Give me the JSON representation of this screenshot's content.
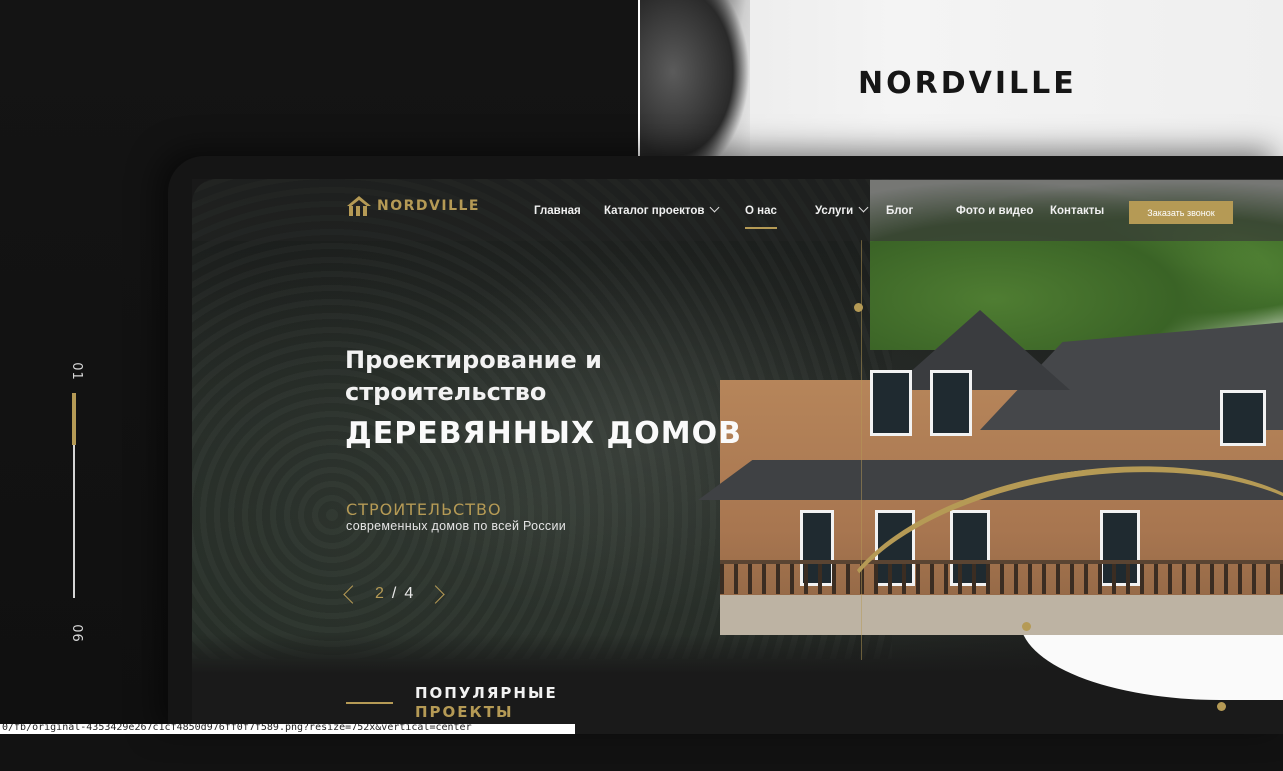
{
  "top_banner": {
    "brand": "NORDVILLE"
  },
  "side_slider": {
    "current": "01",
    "total": "06"
  },
  "nav": {
    "logo_text": "NORDVILLE",
    "items": [
      {
        "label": "Главная"
      },
      {
        "label": "Каталог проектов"
      },
      {
        "label": "О нас"
      },
      {
        "label": "Услуги"
      },
      {
        "label": "Блог"
      },
      {
        "label": "Фото и видео"
      },
      {
        "label": "Контакты"
      }
    ],
    "active_item": "О нас",
    "cta_label": "Заказать звонок"
  },
  "hero": {
    "title_line1": "Проектирование и строительство",
    "title_line2": "ДЕРЕВЯННЫХ ДОМОВ",
    "subtitle_title": "СТРОИТЕЛЬСТВО",
    "subtitle_desc": "современных домов по всей России",
    "pager": {
      "current": "2",
      "separator": "/",
      "total": "4"
    }
  },
  "popular": {
    "line1": "ПОПУЛЯРНЫЕ",
    "line2": "ПРОЕКТЫ"
  },
  "url_fragment": "0/fb/original-4353429e267c1cf4850d976ff0f7f589.png?resize=752x&vertical=center",
  "colors": {
    "accent": "#b59a55",
    "dark": "#121212"
  }
}
